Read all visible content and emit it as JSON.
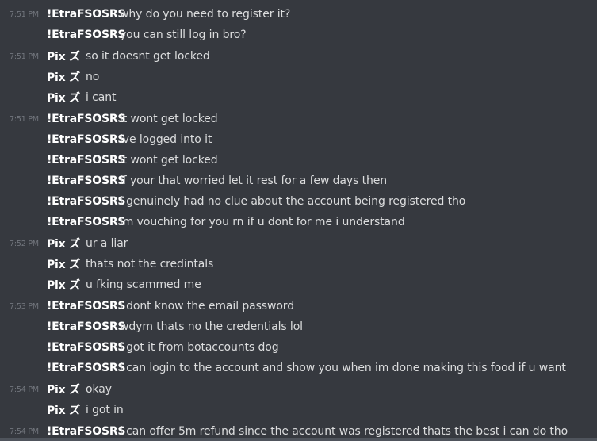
{
  "messages": [
    {
      "timestamp": "7:51 PM",
      "author": "!EtraFSOSRS",
      "text": "why do you need to register it?"
    },
    {
      "timestamp": "",
      "author": "!EtraFSOSRS",
      "text": "you can still log in bro?"
    },
    {
      "timestamp": "7:51 PM",
      "author": "Pix ズ",
      "text": "so it doesnt get locked"
    },
    {
      "timestamp": "",
      "author": "Pix ズ",
      "text": "no"
    },
    {
      "timestamp": "",
      "author": "Pix ズ",
      "text": "i cant"
    },
    {
      "timestamp": "7:51 PM",
      "author": "!EtraFSOSRS",
      "text": "it wont get locked"
    },
    {
      "timestamp": "",
      "author": "!EtraFSOSRS",
      "text": "ive logged into it"
    },
    {
      "timestamp": "",
      "author": "!EtraFSOSRS",
      "text": "it wont get locked"
    },
    {
      "timestamp": "",
      "author": "!EtraFSOSRS",
      "text": "if your that worried let it rest for a few days then"
    },
    {
      "timestamp": "",
      "author": "!EtraFSOSRS",
      "text": "i genuinely had no clue about the account being registered tho"
    },
    {
      "timestamp": "",
      "author": "!EtraFSOSRS",
      "text": "im vouching for you rn if u dont for me i understand"
    },
    {
      "timestamp": "7:52 PM",
      "author": "Pix ズ",
      "text": "ur a liar"
    },
    {
      "timestamp": "",
      "author": "Pix ズ",
      "text": "thats not the credintals"
    },
    {
      "timestamp": "",
      "author": "Pix ズ",
      "text": "u fking scammed me"
    },
    {
      "timestamp": "7:53 PM",
      "author": "!EtraFSOSRS",
      "text": "i dont know the email password"
    },
    {
      "timestamp": "",
      "author": "!EtraFSOSRS",
      "text": "wdym thats no the credentials lol"
    },
    {
      "timestamp": "",
      "author": "!EtraFSOSRS",
      "text": "i got it from botaccounts dog"
    },
    {
      "timestamp": "",
      "author": "!EtraFSOSRS",
      "text": "i can login to the account and show you when im done making this food if u want"
    },
    {
      "timestamp": "7:54 PM",
      "author": "Pix ズ",
      "text": "okay"
    },
    {
      "timestamp": "",
      "author": "Pix ズ",
      "text": "i got in"
    },
    {
      "timestamp": "7:54 PM",
      "author": "!EtraFSOSRS",
      "text": "i can offer 5m refund since the account was registered thats the best i can do tho"
    }
  ]
}
